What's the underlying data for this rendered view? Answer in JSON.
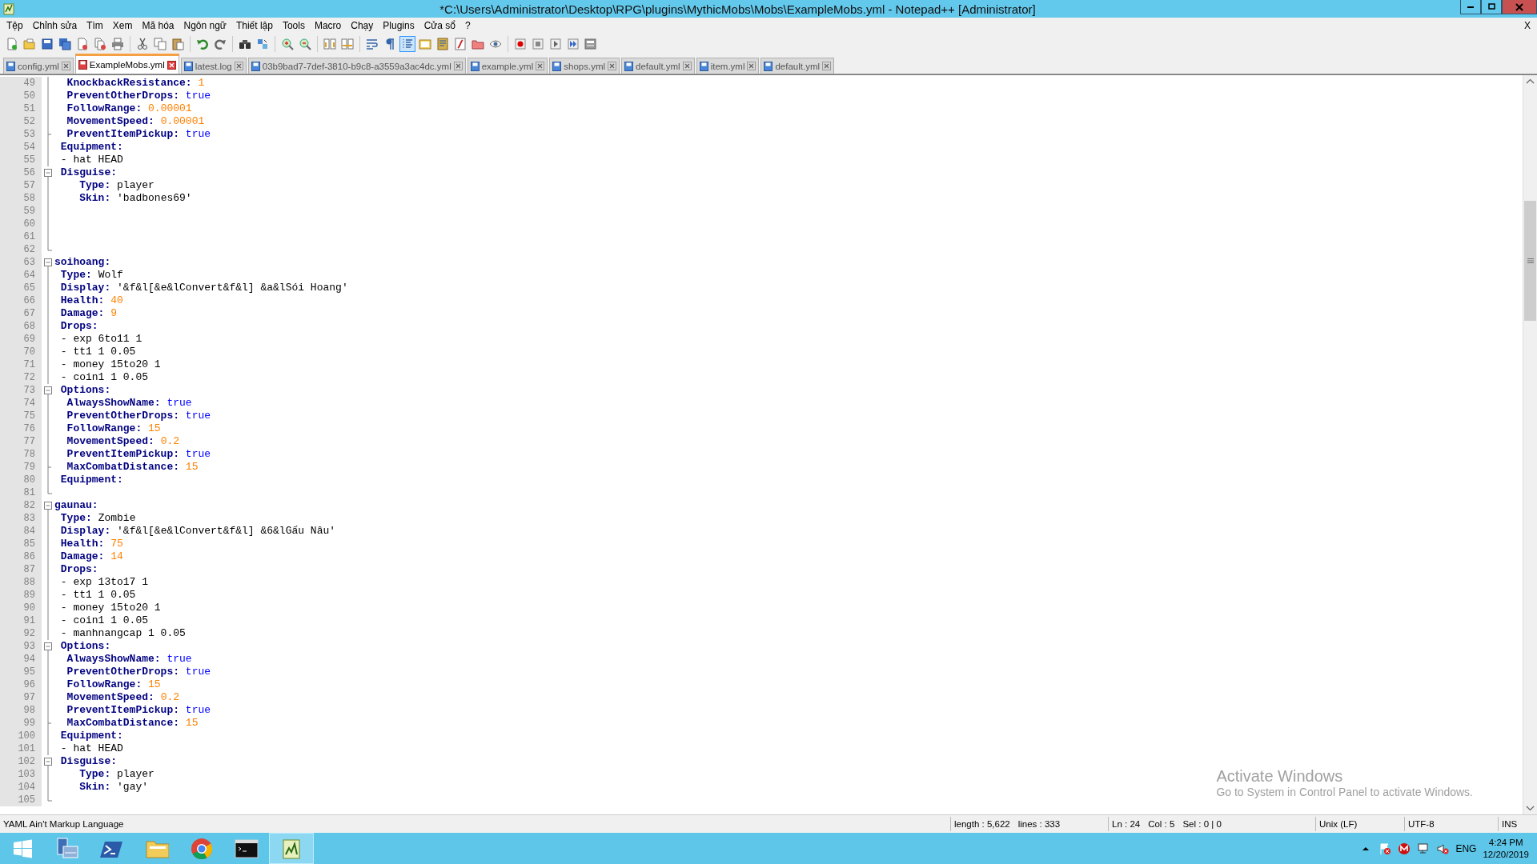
{
  "window": {
    "title": "*C:\\Users\\Administrator\\Desktop\\RPG\\plugins\\MythicMobs\\Mobs\\ExampleMobs.yml - Notepad++ [Administrator]"
  },
  "menu": {
    "items": [
      "Tệp",
      "Chỉnh sửa",
      "Tìm",
      "Xem",
      "Mã hóa",
      "Ngôn ngữ",
      "Thiết lập",
      "Tools",
      "Macro",
      "Chạy",
      "Plugins",
      "Cửa sổ",
      "?"
    ],
    "close_label": "X"
  },
  "toolbar": [
    {
      "kind": "new",
      "pressed": false
    },
    {
      "kind": "open",
      "pressed": false
    },
    {
      "kind": "save",
      "pressed": false
    },
    {
      "kind": "save-all",
      "pressed": false
    },
    {
      "kind": "close",
      "pressed": false
    },
    {
      "kind": "close-all",
      "pressed": false
    },
    {
      "kind": "print",
      "pressed": false
    },
    {
      "kind": "separator"
    },
    {
      "kind": "cut",
      "pressed": false
    },
    {
      "kind": "copy",
      "pressed": false
    },
    {
      "kind": "paste",
      "pressed": false
    },
    {
      "kind": "separator"
    },
    {
      "kind": "undo",
      "pressed": false
    },
    {
      "kind": "redo",
      "pressed": false
    },
    {
      "kind": "separator"
    },
    {
      "kind": "find",
      "pressed": false
    },
    {
      "kind": "replace",
      "pressed": false
    },
    {
      "kind": "separator"
    },
    {
      "kind": "zoom-in",
      "pressed": false
    },
    {
      "kind": "zoom-out",
      "pressed": false
    },
    {
      "kind": "separator"
    },
    {
      "kind": "sync-v",
      "pressed": false
    },
    {
      "kind": "sync-h",
      "pressed": false
    },
    {
      "kind": "separator"
    },
    {
      "kind": "wrap",
      "pressed": false
    },
    {
      "kind": "pilcrow",
      "pressed": false
    },
    {
      "kind": "indent-guide",
      "pressed": true
    },
    {
      "kind": "lang",
      "pressed": false
    },
    {
      "kind": "doc-map",
      "pressed": false
    },
    {
      "kind": "func-list",
      "pressed": false
    },
    {
      "kind": "folder",
      "pressed": false
    },
    {
      "kind": "eye",
      "pressed": false
    },
    {
      "kind": "separator"
    },
    {
      "kind": "record",
      "pressed": false
    },
    {
      "kind": "stop",
      "pressed": false
    },
    {
      "kind": "play",
      "pressed": false
    },
    {
      "kind": "play-multi",
      "pressed": false
    },
    {
      "kind": "save-macro",
      "pressed": false
    }
  ],
  "tabs": [
    {
      "label": "config.yml",
      "selected": false,
      "modified": false
    },
    {
      "label": "ExampleMobs.yml",
      "selected": true,
      "modified": true
    },
    {
      "label": "latest.log",
      "selected": false,
      "modified": false
    },
    {
      "label": "03b9bad7-7def-3810-b9c8-a3559a3ac4dc.yml",
      "selected": false,
      "modified": false
    },
    {
      "label": "example.yml",
      "selected": false,
      "modified": false
    },
    {
      "label": "shops.yml",
      "selected": false,
      "modified": false
    },
    {
      "label": "default.yml",
      "selected": false,
      "modified": false
    },
    {
      "label": "item.yml",
      "selected": false,
      "modified": false
    },
    {
      "label": "default.yml",
      "selected": false,
      "modified": false
    }
  ],
  "editor": {
    "lines": [
      {
        "n": "49",
        "fold": {
          "kind": "line"
        },
        "indent": {
          "kind": "option"
        },
        "key": "KnockbackResistance:",
        "value": {
          "text": "1",
          "kind": "number"
        }
      },
      {
        "n": "50",
        "fold": {
          "kind": "line"
        },
        "indent": {
          "kind": "option"
        },
        "key": "PreventOtherDrops:",
        "value": {
          "text": "true",
          "kind": "bool"
        }
      },
      {
        "n": "51",
        "fold": {
          "kind": "line"
        },
        "indent": {
          "kind": "option"
        },
        "key": "FollowRange:",
        "value": {
          "text": "0.00001",
          "kind": "number"
        }
      },
      {
        "n": "52",
        "fold": {
          "kind": "line"
        },
        "indent": {
          "kind": "option"
        },
        "key": "MovementSpeed:",
        "value": {
          "text": "0.00001",
          "kind": "number"
        }
      },
      {
        "n": "53",
        "fold": {
          "kind": "tick"
        },
        "indent": {
          "kind": "option"
        },
        "key": "PreventItemPickup:",
        "value": {
          "text": "true",
          "kind": "bool"
        }
      },
      {
        "n": "54",
        "fold": {
          "kind": "line"
        },
        "indent": {
          "kind": "child"
        },
        "key": "Equipment:"
      },
      {
        "n": "55",
        "fold": {
          "kind": "line"
        },
        "indent": {
          "kind": "child"
        },
        "value": {
          "text": "- hat HEAD",
          "kind": "plain"
        }
      },
      {
        "n": "56",
        "fold": {
          "kind": "open"
        },
        "indent": {
          "kind": "child"
        },
        "key": "Disguise:"
      },
      {
        "n": "57",
        "fold": {
          "kind": "line"
        },
        "indent": {
          "kind": "nested"
        },
        "key": "Type:",
        "value": {
          "text": "player",
          "kind": "plain"
        }
      },
      {
        "n": "58",
        "fold": {
          "kind": "line"
        },
        "indent": {
          "kind": "nested"
        },
        "key": "Skin:",
        "value": {
          "text": "'badbones69'",
          "kind": "plain"
        }
      },
      {
        "n": "59",
        "fold": {
          "kind": "line"
        }
      },
      {
        "n": "60",
        "fold": {
          "kind": "line"
        }
      },
      {
        "n": "61",
        "fold": {
          "kind": "line"
        }
      },
      {
        "n": "62",
        "fold": {
          "kind": "end"
        }
      },
      {
        "n": "63",
        "fold": {
          "kind": "open"
        },
        "key": "soihoang:"
      },
      {
        "n": "64",
        "fold": {
          "kind": "line"
        },
        "indent": {
          "kind": "child"
        },
        "key": "Type:",
        "value": {
          "text": "Wolf",
          "kind": "plain"
        }
      },
      {
        "n": "65",
        "fold": {
          "kind": "line"
        },
        "indent": {
          "kind": "child"
        },
        "key": "Display:",
        "value": {
          "text": "'&f&l[&e&lConvert&f&l] &a&lSói Hoang'",
          "kind": "plain"
        }
      },
      {
        "n": "66",
        "fold": {
          "kind": "line"
        },
        "indent": {
          "kind": "child"
        },
        "key": "Health:",
        "value": {
          "text": "40",
          "kind": "number"
        }
      },
      {
        "n": "67",
        "fold": {
          "kind": "line"
        },
        "indent": {
          "kind": "child"
        },
        "key": "Damage:",
        "value": {
          "text": "9",
          "kind": "number"
        }
      },
      {
        "n": "68",
        "fold": {
          "kind": "line"
        },
        "indent": {
          "kind": "child"
        },
        "key": "Drops:"
      },
      {
        "n": "69",
        "fold": {
          "kind": "line"
        },
        "indent": {
          "kind": "child"
        },
        "value": {
          "text": "- exp 6to11 1",
          "kind": "plain"
        }
      },
      {
        "n": "70",
        "fold": {
          "kind": "line"
        },
        "indent": {
          "kind": "child"
        },
        "value": {
          "text": "- tt1 1 0.05",
          "kind": "plain"
        }
      },
      {
        "n": "71",
        "fold": {
          "kind": "line"
        },
        "indent": {
          "kind": "child"
        },
        "value": {
          "text": "- money 15to20 1",
          "kind": "plain"
        }
      },
      {
        "n": "72",
        "fold": {
          "kind": "line"
        },
        "indent": {
          "kind": "child"
        },
        "value": {
          "text": "- coin1 1 0.05",
          "kind": "plain"
        }
      },
      {
        "n": "73",
        "fold": {
          "kind": "open"
        },
        "indent": {
          "kind": "child"
        },
        "key": "Options:"
      },
      {
        "n": "74",
        "fold": {
          "kind": "line"
        },
        "indent": {
          "kind": "option"
        },
        "key": "AlwaysShowName:",
        "value": {
          "text": "true",
          "kind": "bool"
        }
      },
      {
        "n": "75",
        "fold": {
          "kind": "line"
        },
        "indent": {
          "kind": "option"
        },
        "key": "PreventOtherDrops:",
        "value": {
          "text": "true",
          "kind": "bool"
        }
      },
      {
        "n": "76",
        "fold": {
          "kind": "line"
        },
        "indent": {
          "kind": "option"
        },
        "key": "FollowRange:",
        "value": {
          "text": "15",
          "kind": "number"
        }
      },
      {
        "n": "77",
        "fold": {
          "kind": "line"
        },
        "indent": {
          "kind": "option"
        },
        "key": "MovementSpeed:",
        "value": {
          "text": "0.2",
          "kind": "number"
        }
      },
      {
        "n": "78",
        "fold": {
          "kind": "line"
        },
        "indent": {
          "kind": "option"
        },
        "key": "PreventItemPickup:",
        "value": {
          "text": "true",
          "kind": "bool"
        }
      },
      {
        "n": "79",
        "fold": {
          "kind": "tick"
        },
        "indent": {
          "kind": "option"
        },
        "key": "MaxCombatDistance:",
        "value": {
          "text": "15",
          "kind": "number"
        }
      },
      {
        "n": "80",
        "fold": {
          "kind": "line"
        },
        "indent": {
          "kind": "child"
        },
        "key": "Equipment:"
      },
      {
        "n": "81",
        "fold": {
          "kind": "end"
        }
      },
      {
        "n": "82",
        "fold": {
          "kind": "open"
        },
        "key": "gaunau:"
      },
      {
        "n": "83",
        "fold": {
          "kind": "line"
        },
        "indent": {
          "kind": "child"
        },
        "key": "Type:",
        "value": {
          "text": "Zombie",
          "kind": "plain"
        }
      },
      {
        "n": "84",
        "fold": {
          "kind": "line"
        },
        "indent": {
          "kind": "child"
        },
        "key": "Display:",
        "value": {
          "text": "'&f&l[&e&lConvert&f&l] &6&lGấu Nâu'",
          "kind": "plain"
        }
      },
      {
        "n": "85",
        "fold": {
          "kind": "line"
        },
        "indent": {
          "kind": "child"
        },
        "key": "Health:",
        "value": {
          "text": "75",
          "kind": "number"
        }
      },
      {
        "n": "86",
        "fold": {
          "kind": "line"
        },
        "indent": {
          "kind": "child"
        },
        "key": "Damage:",
        "value": {
          "text": "14",
          "kind": "number"
        }
      },
      {
        "n": "87",
        "fold": {
          "kind": "line"
        },
        "indent": {
          "kind": "child"
        },
        "key": "Drops:"
      },
      {
        "n": "88",
        "fold": {
          "kind": "line"
        },
        "indent": {
          "kind": "child"
        },
        "value": {
          "text": "- exp 13to17 1",
          "kind": "plain"
        }
      },
      {
        "n": "89",
        "fold": {
          "kind": "line"
        },
        "indent": {
          "kind": "child"
        },
        "value": {
          "text": "- tt1 1 0.05",
          "kind": "plain"
        }
      },
      {
        "n": "90",
        "fold": {
          "kind": "line"
        },
        "indent": {
          "kind": "child"
        },
        "value": {
          "text": "- money 15to20 1",
          "kind": "plain"
        }
      },
      {
        "n": "91",
        "fold": {
          "kind": "line"
        },
        "indent": {
          "kind": "child"
        },
        "value": {
          "text": "- coin1 1 0.05",
          "kind": "plain"
        }
      },
      {
        "n": "92",
        "fold": {
          "kind": "line"
        },
        "indent": {
          "kind": "child"
        },
        "value": {
          "text": "- manhnangcap 1 0.05",
          "kind": "plain"
        }
      },
      {
        "n": "93",
        "fold": {
          "kind": "open"
        },
        "indent": {
          "kind": "child"
        },
        "key": "Options:"
      },
      {
        "n": "94",
        "fold": {
          "kind": "line"
        },
        "indent": {
          "kind": "option"
        },
        "key": "AlwaysShowName:",
        "value": {
          "text": "true",
          "kind": "bool"
        }
      },
      {
        "n": "95",
        "fold": {
          "kind": "line"
        },
        "indent": {
          "kind": "option"
        },
        "key": "PreventOtherDrops:",
        "value": {
          "text": "true",
          "kind": "bool"
        }
      },
      {
        "n": "96",
        "fold": {
          "kind": "line"
        },
        "indent": {
          "kind": "option"
        },
        "key": "FollowRange:",
        "value": {
          "text": "15",
          "kind": "number"
        }
      },
      {
        "n": "97",
        "fold": {
          "kind": "line"
        },
        "indent": {
          "kind": "option"
        },
        "key": "MovementSpeed:",
        "value": {
          "text": "0.2",
          "kind": "number"
        }
      },
      {
        "n": "98",
        "fold": {
          "kind": "line"
        },
        "indent": {
          "kind": "option"
        },
        "key": "PreventItemPickup:",
        "value": {
          "text": "true",
          "kind": "bool"
        }
      },
      {
        "n": "99",
        "fold": {
          "kind": "tick"
        },
        "indent": {
          "kind": "option"
        },
        "key": "MaxCombatDistance:",
        "value": {
          "text": "15",
          "kind": "number"
        }
      },
      {
        "n": "100",
        "fold": {
          "kind": "line"
        },
        "indent": {
          "kind": "child"
        },
        "key": "Equipment:"
      },
      {
        "n": "101",
        "fold": {
          "kind": "line"
        },
        "indent": {
          "kind": "child"
        },
        "value": {
          "text": "- hat HEAD",
          "kind": "plain"
        }
      },
      {
        "n": "102",
        "fold": {
          "kind": "open"
        },
        "indent": {
          "kind": "child"
        },
        "key": "Disguise:"
      },
      {
        "n": "103",
        "fold": {
          "kind": "line"
        },
        "indent": {
          "kind": "nested"
        },
        "key": "Type:",
        "value": {
          "text": "player",
          "kind": "plain"
        }
      },
      {
        "n": "104",
        "fold": {
          "kind": "line"
        },
        "indent": {
          "kind": "nested"
        },
        "key": "Skin:",
        "value": {
          "text": "'gay'",
          "kind": "plain"
        }
      },
      {
        "n": "105",
        "fold": {
          "kind": "end"
        }
      }
    ]
  },
  "activation_notice": {
    "title": "Activate Windows",
    "text": "Go to System in Control Panel to activate Windows."
  },
  "status_bar": {
    "language": "YAML Ain't Markup Language",
    "length": "length : 5,622",
    "lines": "lines : 333",
    "ln": "Ln : 24",
    "col": "Col : 5",
    "sel": "Sel : 0 | 0",
    "eol": "Unix (LF)",
    "encoding": "UTF-8",
    "mode": "INS"
  },
  "taskbar": {
    "apps": [
      {
        "kind": "server-manager",
        "active": false
      },
      {
        "kind": "powershell",
        "active": false
      },
      {
        "kind": "explorer",
        "active": false
      },
      {
        "kind": "chrome",
        "active": false
      },
      {
        "kind": "cmd",
        "active": false
      },
      {
        "kind": "notepad",
        "active": true
      }
    ],
    "language": "ENG",
    "time": "4:24 PM",
    "date": "12/20/2019"
  }
}
